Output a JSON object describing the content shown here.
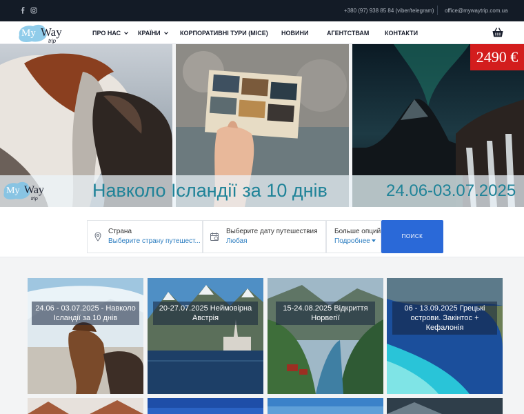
{
  "topbar": {
    "phone": "+380 (97) 938 85 84 (viber/telegram)",
    "email": "office@mywaytrip.com.ua",
    "social": [
      "facebook-icon",
      "instagram-icon"
    ]
  },
  "brand": {
    "name_my": "My",
    "name_way": "Way",
    "name_trip": "trip"
  },
  "nav": {
    "items": [
      "ПРО НАС",
      "КРАЇНИ",
      "КОРПОРАТИВНІ ТУРИ (MICE)",
      "НОВИНИ",
      "АГЕНТСТВАМ",
      "КОНТАКТИ"
    ],
    "cart_icon": "basket-icon"
  },
  "hero": {
    "price": "2490 €",
    "title": "Навколо Ісландії за 10 днів",
    "dates": "24.06-03.07.2025"
  },
  "search": {
    "country_label": "Страна",
    "country_value": "Выберите страну путешест...",
    "date_label": "Выберите дату путешествия",
    "date_value": "Любая",
    "more_label": "Больше опций",
    "more_value": "Подробнее",
    "button": "ПОИСК"
  },
  "tours": [
    {
      "title": "24.06 - 03.07.2025 - Навколо Ісландії за 10 днів"
    },
    {
      "title": "20-27.07.2025 Неймовірна Австрія"
    },
    {
      "title": "15-24.08.2025 Відкриття Норвегії"
    },
    {
      "title": "06 - 13.09.2025 Грецькі острови. Закінтос + Кефалонія"
    }
  ],
  "colors": {
    "accent_blue": "#2a69d8",
    "price_red": "#d31d1d",
    "topbar": "#131b26",
    "hero_text": "#1f8398"
  }
}
